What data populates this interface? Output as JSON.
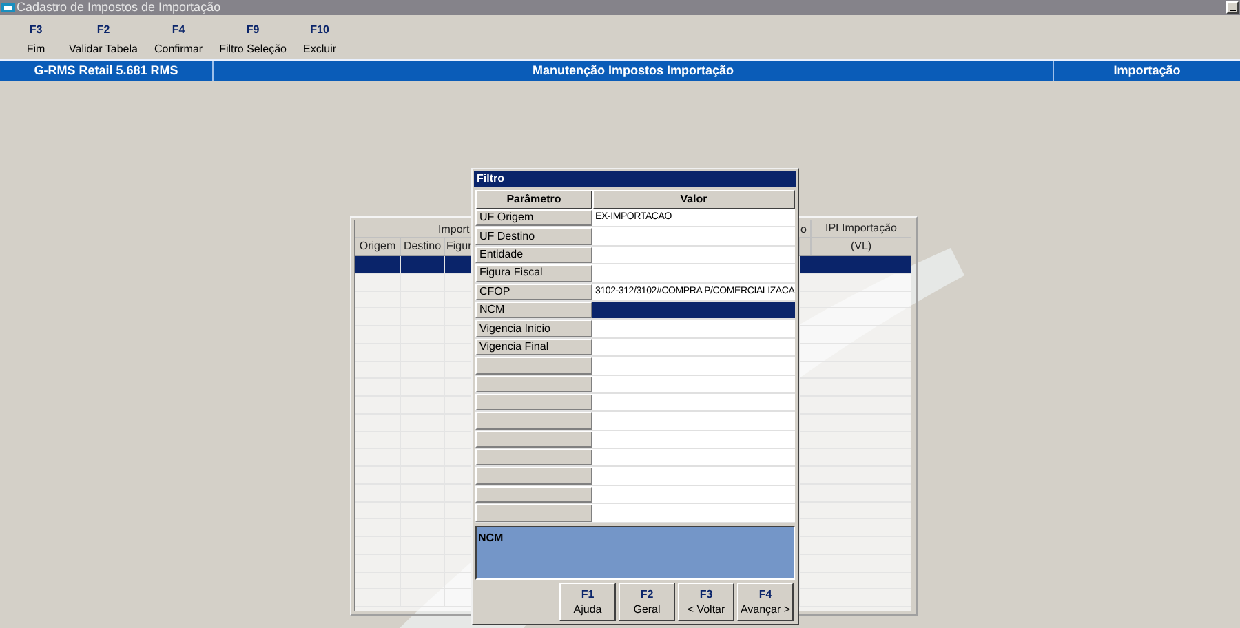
{
  "window": {
    "title": "Cadastro de Impostos de Importação"
  },
  "toolbar": [
    {
      "key": "F3",
      "label": "Fim"
    },
    {
      "key": "F2",
      "label": "Validar Tabela"
    },
    {
      "key": "F4",
      "label": "Confirmar"
    },
    {
      "key": "F9",
      "label": "Filtro Seleção"
    },
    {
      "key": "F10",
      "label": "Excluir"
    }
  ],
  "header_bar": {
    "system": "G-RMS Retail 5.681 RMS",
    "screen": "Manutenção Impostos Importação",
    "module": "Importação"
  },
  "table": {
    "group_header": "Import",
    "right_header_fragment": "o",
    "columns": [
      "Origem",
      "Destino",
      "Figur"
    ],
    "last_column": {
      "title": "IPI Importação",
      "unit": "(VL)"
    },
    "rows": [
      {
        "selected": true
      },
      {
        "selected": false
      },
      {
        "selected": false
      },
      {
        "selected": false
      },
      {
        "selected": false
      },
      {
        "selected": false
      },
      {
        "selected": false
      },
      {
        "selected": false
      },
      {
        "selected": false
      },
      {
        "selected": false
      },
      {
        "selected": false
      },
      {
        "selected": false
      },
      {
        "selected": false
      },
      {
        "selected": false
      },
      {
        "selected": false
      },
      {
        "selected": false
      },
      {
        "selected": false
      },
      {
        "selected": false
      },
      {
        "selected": false
      },
      {
        "selected": false
      }
    ]
  },
  "dialog": {
    "title": "Filtro",
    "columns": [
      "Parâmetro",
      "Valor"
    ],
    "rows": [
      {
        "parameter": "UF Origem",
        "value": "EX-IMPORTACAO",
        "selected": false
      },
      {
        "parameter": "UF Destino",
        "selected": false
      },
      {
        "parameter": "Entidade",
        "selected": false
      },
      {
        "parameter": "Figura Fiscal",
        "selected": false
      },
      {
        "parameter": "CFOP",
        "value": "3102-312/3102#COMPRA P/COMERCIALIZACA",
        "selected": false
      },
      {
        "parameter": "NCM",
        "selected": true
      },
      {
        "parameter": "Vigencia Inicio",
        "selected": false
      },
      {
        "parameter": "Vigencia Final",
        "selected": false
      },
      {
        "selected": false
      },
      {
        "selected": false
      },
      {
        "selected": false
      },
      {
        "selected": false
      },
      {
        "selected": false
      },
      {
        "selected": false
      },
      {
        "selected": false
      },
      {
        "selected": false
      },
      {
        "selected": false
      }
    ],
    "description": "NCM",
    "buttons": [
      {
        "key": "F1",
        "label": "Ajuda"
      },
      {
        "key": "F2",
        "label": "Geral"
      },
      {
        "key": "F3",
        "label": "< Voltar"
      },
      {
        "key": "F4",
        "label": "Avançar >"
      }
    ]
  }
}
